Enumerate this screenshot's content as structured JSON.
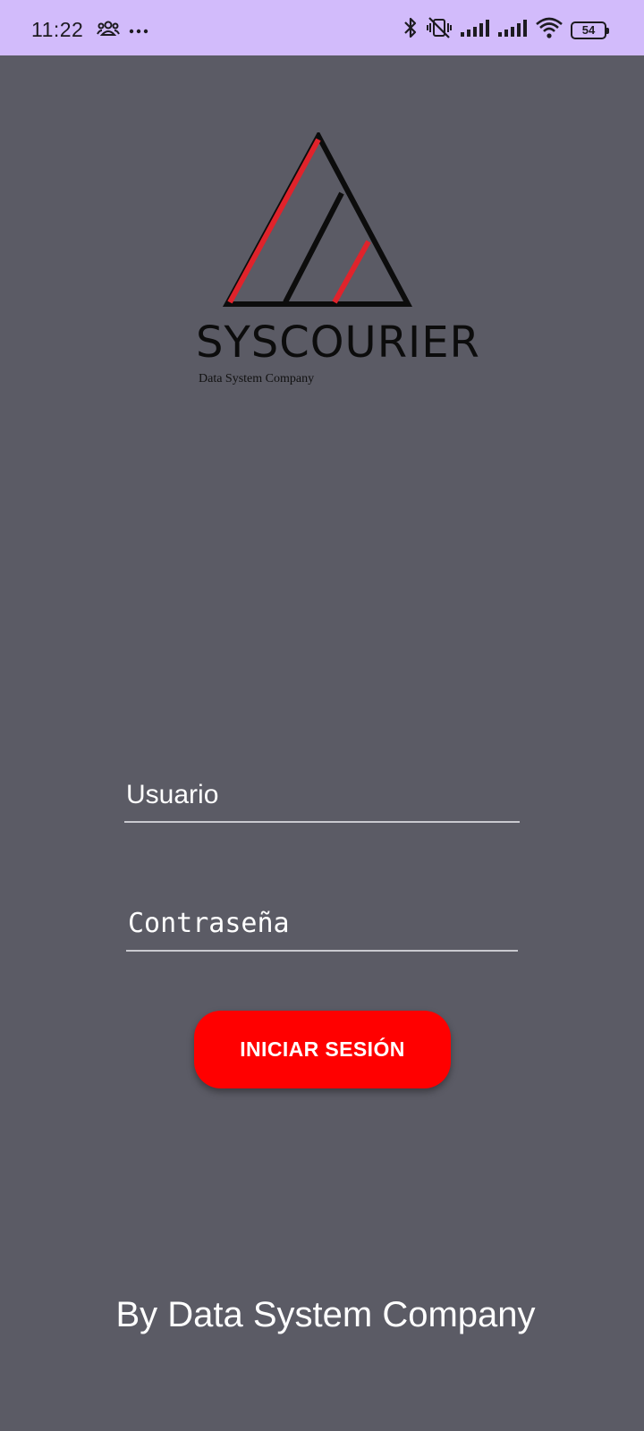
{
  "status_bar": {
    "time": "11:22",
    "icons_left": [
      "people-icon",
      "more-dots-icon"
    ],
    "icons_right": [
      "bluetooth-icon",
      "vibrate-off-icon",
      "signal-icon",
      "signal-icon",
      "wifi-icon",
      "battery-icon"
    ],
    "battery_level": "54"
  },
  "logo": {
    "title": "SYSCOURIER",
    "subtitle": "Data System Company",
    "accent_color": "#e0232b"
  },
  "form": {
    "username_placeholder": "Usuario",
    "password_placeholder": "Contraseña",
    "login_button": "INICIAR SESIÓN"
  },
  "footer": {
    "text": "By Data System Company"
  },
  "colors": {
    "background": "#5b5b65",
    "status_bar": "#d2bbfb",
    "button": "#ff0000"
  }
}
